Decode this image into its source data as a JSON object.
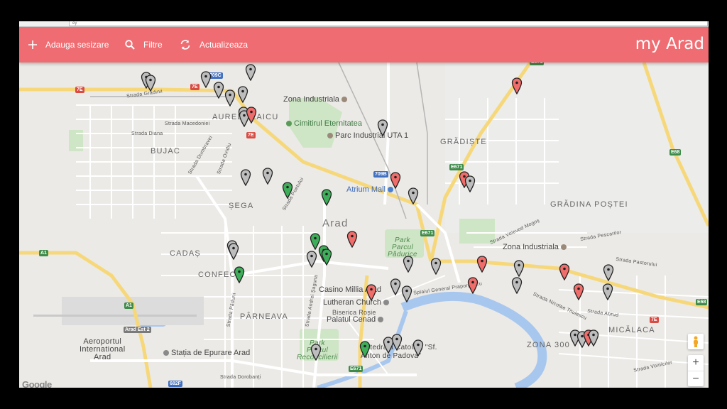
{
  "browser": {
    "address_text": "ey"
  },
  "toolbar": {
    "add_label": "Adauga sesizare",
    "filter_label": "Filtre",
    "refresh_label": "Actualizeaza",
    "brand": "my Arad",
    "color": "#ef6d72"
  },
  "map": {
    "areas": {
      "aurel_vlaicu": "AUREL VLAICU",
      "bujac": "BUJAC",
      "sega": "ȘEGA",
      "gradiste": "GRĂDIȘTE",
      "gradina_postei": "GRĂDINA POȘTEI",
      "arad": "Arad",
      "cadas": "CADAȘ",
      "confectii": "CONFECȚ",
      "parneava": "PÂRNEAVA",
      "micalaca": "MICĂLACA",
      "zona300": "ZONA 300"
    },
    "pois": {
      "zona_ind_n": "Zona Industriala",
      "cimitir": "Cimitirul Eternitatea",
      "parc_uta": "Parc Industrial UTA 1",
      "atrium": "Atrium Mall",
      "zona_ind_e": "Zona Industriala",
      "casino": "Casino Millia Arad",
      "lutheran": "Lutheran Church",
      "biserica_rosie": "Biserica Roșie",
      "palatul": "Palatul Cenad",
      "statie": "Stația de Epurare Arad",
      "aeroport_1": "Aeroportul",
      "aeroport_2": "International",
      "aeroport_3": "Arad",
      "park_padurice_1": "Park",
      "park_padurice_2": "Parcul",
      "park_padurice_3": "Pădurice",
      "park_reconc_1": "Park",
      "park_reconc_2": "Parcul",
      "park_reconc_3": "Reconcilierii",
      "catedrala_1": "Catedrala Catolică \"Sf.",
      "catedrala_2": "Anton de Padova\""
    },
    "streets": {
      "s1": "Strada Grădinii",
      "s2": "Strada Diana",
      "s3": "Strada Macedoniei",
      "s4": "Strada Dumbravei",
      "s5": "Strada Ovidiu",
      "s6": "Strada Gheorghe Lazăr",
      "s7": "Strada Dorobanți",
      "s8": "Strada Pescarilor",
      "s9": "Strada Pădurii",
      "s10": "Splaiul General Praporgescu",
      "s11": "Strada Abrud",
      "s12": "Strada Voinicilor",
      "s13": "Strada Pastorului",
      "s14": "Strada Nicolae Titulescu",
      "s15": "Strada Andrei Șaguna",
      "s16": "Strada Poetului",
      "s17": "Strada Voievod Mogoș"
    },
    "shields": {
      "r7e_a": "7E",
      "r7e_b": "7E",
      "r7e_c": "7E",
      "r7e_d": "7E",
      "r709c": "709C",
      "r709b": "709B",
      "e671_a": "E671",
      "e671_b": "E671",
      "e671_c": "E671",
      "e671_d": "E671",
      "e68_a": "E68",
      "e68_b": "E68",
      "a1_a": "A1",
      "a1_b": "A1",
      "r682f": "682F",
      "arad_est": "Arad Est 2"
    },
    "marker_colors": {
      "red": "#ef6d6a",
      "green": "#3fae5a",
      "gray": "#bdbdbd"
    },
    "google_logo": "Google"
  }
}
